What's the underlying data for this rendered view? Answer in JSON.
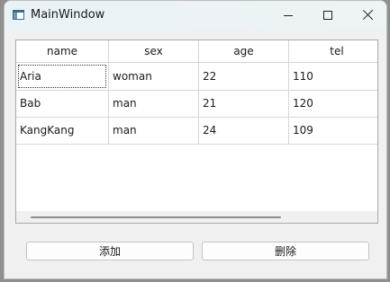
{
  "window": {
    "title": "MainWindow"
  },
  "table": {
    "columns": [
      "name",
      "sex",
      "age",
      "tel"
    ],
    "rows": [
      [
        "Aria",
        "woman",
        "22",
        "110"
      ],
      [
        "Bab",
        "man",
        "21",
        "120"
      ],
      [
        "KangKang",
        "man",
        "24",
        "109"
      ]
    ],
    "focused_cell": "Aria"
  },
  "buttons": {
    "add_label": "添加",
    "delete_label": "删除"
  },
  "icons": {
    "app": "window-app-icon",
    "minimize": "minimize-icon",
    "maximize": "maximize-icon",
    "close": "close-icon"
  }
}
